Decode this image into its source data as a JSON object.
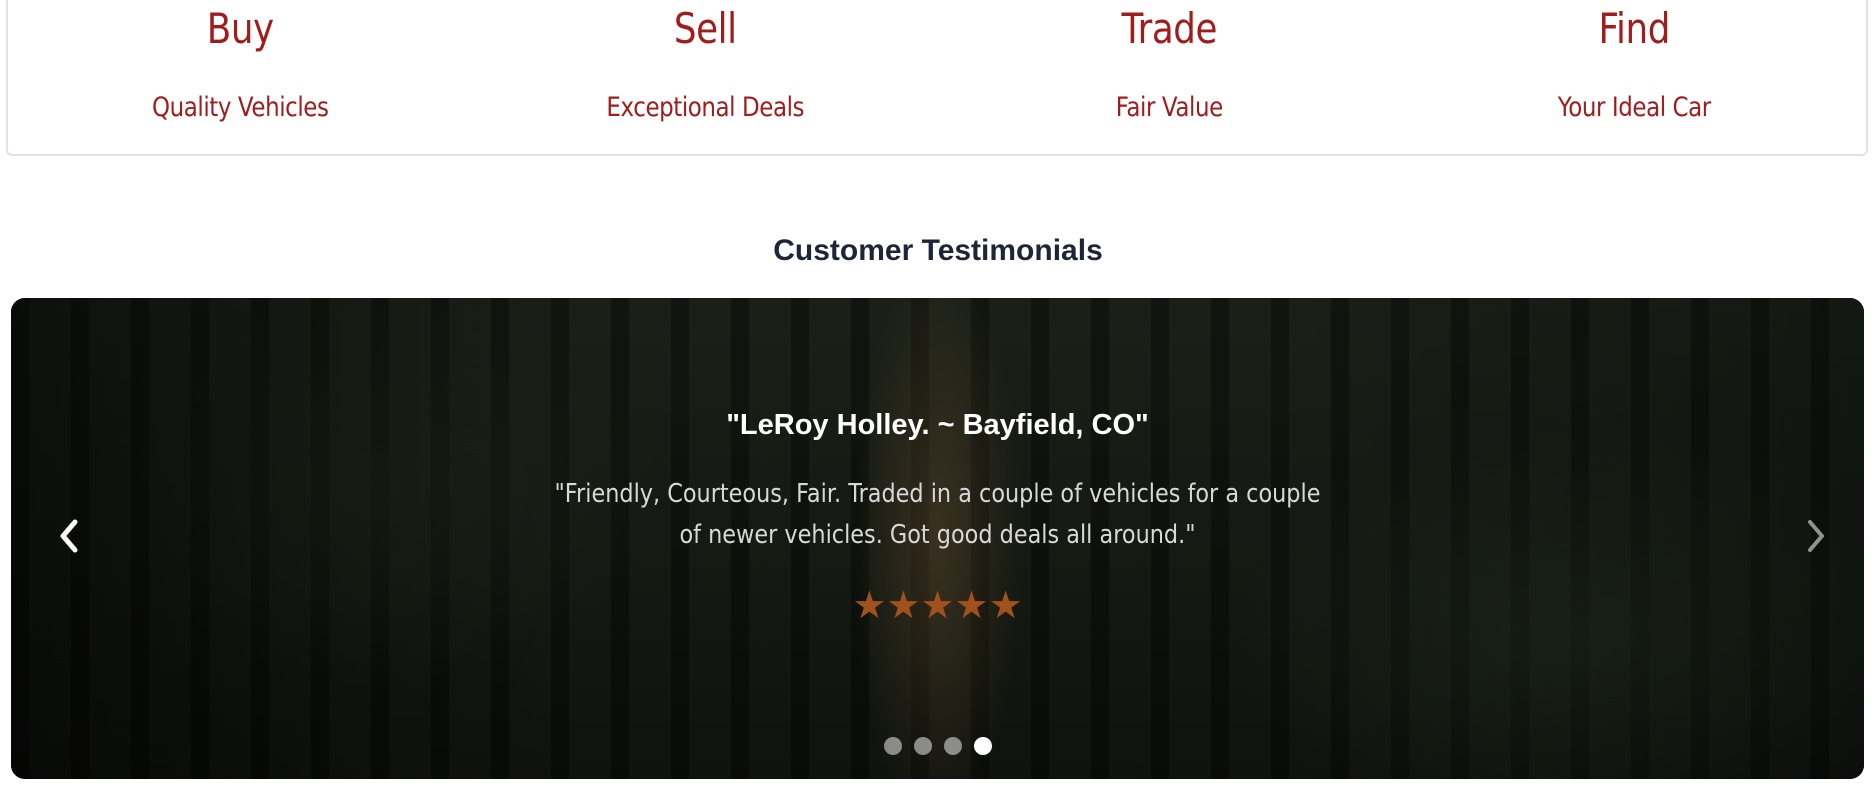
{
  "features": [
    {
      "title": "Buy",
      "subtitle": "Quality Vehicles"
    },
    {
      "title": "Sell",
      "subtitle": "Exceptional Deals"
    },
    {
      "title": "Trade",
      "subtitle": "Fair Value"
    },
    {
      "title": "Find",
      "subtitle": "Your Ideal Car"
    }
  ],
  "testimonials": {
    "heading": "Customer Testimonials",
    "active_slide": {
      "author": "\"LeRoy Holley. ~ Bayfield, CO\"",
      "quote": "\"Friendly, Courteous, Fair. Traded in a couple of vehicles for a couple of newer vehicles. Got good deals all around.\"",
      "rating": 5,
      "stars_text": "★★★★★"
    },
    "slide_count": 4,
    "active_index": 3,
    "prev_icon": "chevron-left-icon",
    "next_icon": "chevron-right-icon"
  },
  "colors": {
    "brand_red": "#a11c1c",
    "heading": "#1c2637",
    "star": "#a0511c"
  }
}
